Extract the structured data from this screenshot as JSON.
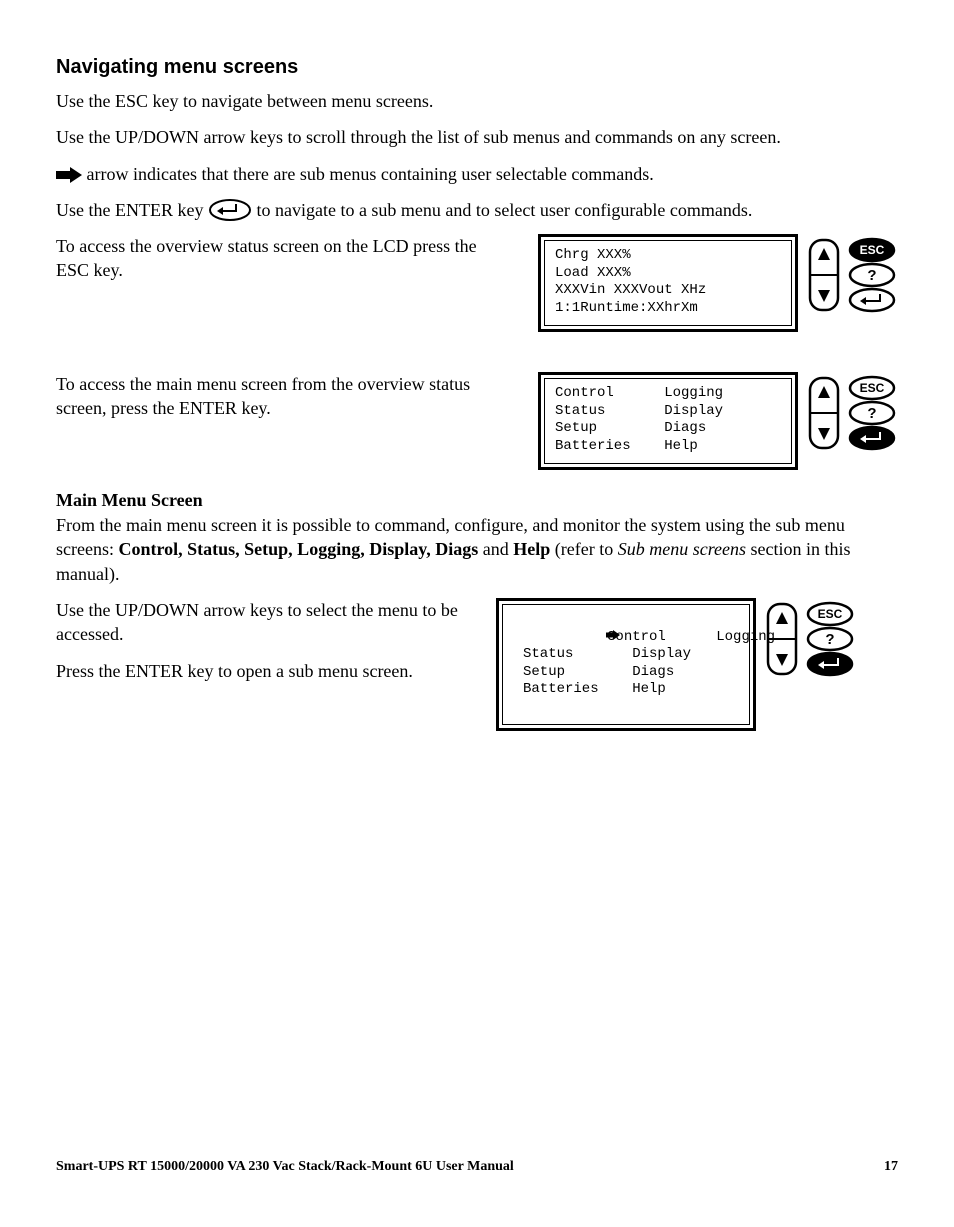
{
  "heading": "Navigating menu screens",
  "p1": "Use the ESC key to navigate between menu screens.",
  "p2": "Use the UP/DOWN arrow keys to scroll through the list of sub menus and commands on any screen.",
  "p3": "arrow indicates that there are sub menus containing user selectable commands.",
  "p4a": "Use the ENTER key",
  "p4b": "to navigate to a sub menu and to select user configurable commands.",
  "p5": "To access the overview status screen on the LCD press the ESC key.",
  "p6": "To access the main menu screen from the overview status screen, press the ENTER key.",
  "subhead": "Main Menu Screen",
  "p7a": "From the main menu screen it is possible to command, configure, and monitor the system using the sub menu screens: ",
  "p7b": "Control, Status, Setup, Logging, Display, Diags",
  "p7c": " and ",
  "p7d": "Help",
  "p7e": " (refer to ",
  "p7f": "Sub menu screens",
  "p7g": " section in this manual).",
  "p8": "Use the UP/DOWN arrow keys to select the menu to be accessed.",
  "p9": "Press the ENTER key to open a sub menu screen.",
  "lcd1": "Chrg XXX%\nLoad XXX%\nXXXVin XXXVout XHz\n1:1Runtime:XXhrXm",
  "lcd2": "Control      Logging\nStatus       Display\nSetup        Diags\nBatteries    Help",
  "lcd3": "Control      Logging\nStatus       Display\nSetup        Diags\nBatteries    Help",
  "keypad": {
    "esc": "ESC",
    "help": "?"
  },
  "footer_left": "Smart-UPS RT 15000/20000 VA  230 Vac  Stack/Rack-Mount 6U  User Manual",
  "footer_right": "17"
}
